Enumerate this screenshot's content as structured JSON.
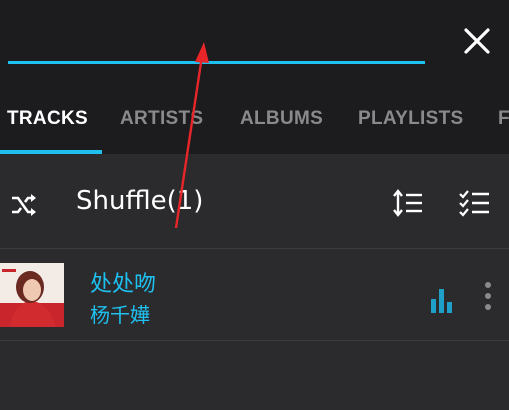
{
  "search": {
    "value": "",
    "placeholder": ""
  },
  "tabs": [
    {
      "label": "TRACKS",
      "active": true
    },
    {
      "label": "ARTISTS",
      "active": false
    },
    {
      "label": "ALBUMS",
      "active": false
    },
    {
      "label": "PLAYLISTS",
      "active": false
    },
    {
      "label": "F",
      "active": false
    }
  ],
  "shuffle": {
    "label": "Shuffle(1)"
  },
  "tracks": [
    {
      "title": "处处吻",
      "artist": "杨千嬅",
      "playing": true
    }
  ],
  "icons": {
    "close": "close-icon",
    "shuffle": "shuffle-icon",
    "sort": "sort-icon",
    "select": "checklist-icon",
    "playing": "equalizer-icon",
    "more": "more-vertical-icon"
  },
  "colors": {
    "accent": "#1ec0f0",
    "background": "#2b2b2e",
    "header": "#1c1c1e",
    "tab_inactive": "#8a8a8d",
    "annotation": "#e8262a"
  }
}
